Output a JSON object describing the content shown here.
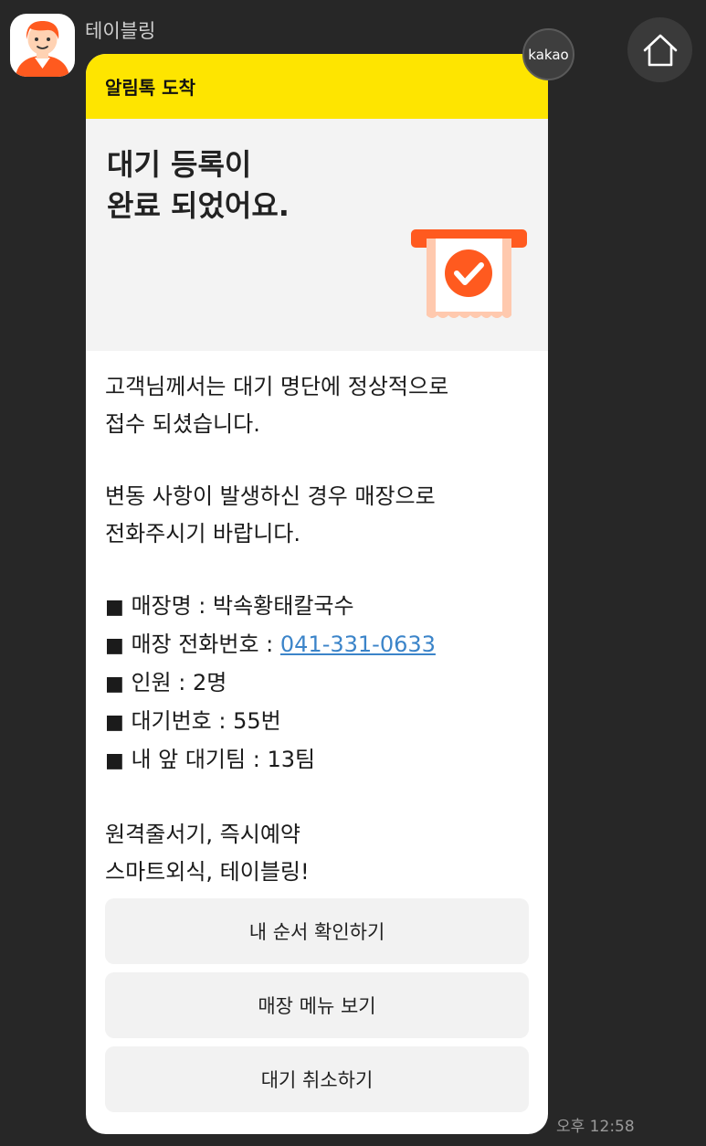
{
  "sender": {
    "name": "테이블링"
  },
  "badge": {
    "label": "kakao"
  },
  "card": {
    "header": "알림톡 도착",
    "title_lines": [
      "대기 등록이",
      "완료 되었어요."
    ],
    "paragraph1": [
      "고객님께서는 대기 명단에 정상적으로",
      "접수 되셨습니다."
    ],
    "paragraph2": [
      "변동 사항이 발생하신 경우 매장으로",
      "전화주시기 바랍니다."
    ],
    "bullet": "■",
    "details": {
      "store_name": "매장명 : 박속황태칼국수",
      "phone_label": "매장 전화번호 : ",
      "phone": "041-331-0633",
      "party": "인원 : 2명",
      "wait_number": "대기번호 : 55번",
      "teams_ahead": "내 앞 대기팀 : 13팀"
    },
    "slogan": [
      "원격줄서기, 즉시예약",
      "스마트외식, 테이블링!"
    ],
    "buttons": {
      "check_order": "내 순서 확인하기",
      "view_menu": "매장 메뉴 보기",
      "cancel_wait": "대기 취소하기"
    }
  },
  "timestamp": "오후 12:58",
  "colors": {
    "background": "#272727",
    "header_yellow": "#fee500",
    "receipt_orange": "#ff5a1f",
    "link_blue": "#3b84c9"
  },
  "icons": {
    "avatar": "person-avatar-icon",
    "home": "home-icon",
    "hero": "receipt-check-icon"
  }
}
